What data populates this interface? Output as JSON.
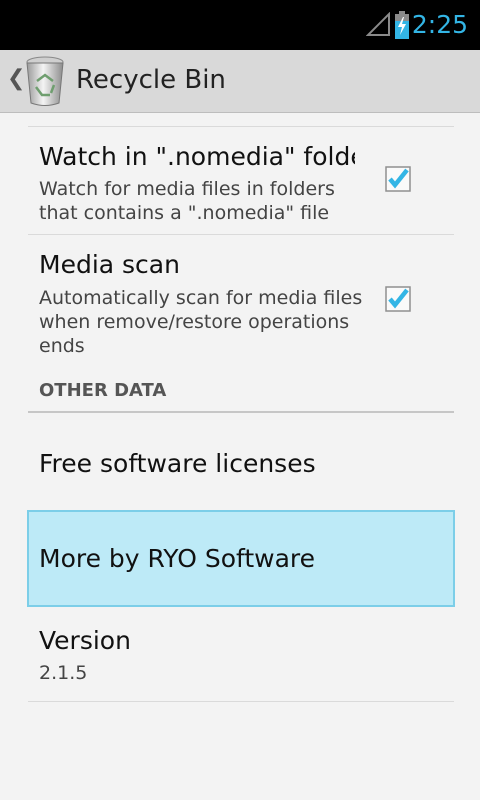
{
  "status_bar": {
    "time": "2:25",
    "icons": [
      "signal-icon",
      "battery-charging-icon"
    ],
    "time_color": "#33b5e5"
  },
  "action_bar": {
    "title": "Recycle Bin",
    "up_icon": "chevron-left-icon",
    "app_icon": "recycle-bin-icon"
  },
  "preferences": [
    {
      "title": "Watch in \".nomedia\" folder",
      "summary": "Watch for media files in folders that contains a \".nomedia\" file",
      "checked": true
    },
    {
      "title": "Media scan",
      "summary": "Automatically scan for media files when remove/restore operations ends",
      "checked": true
    }
  ],
  "section": {
    "label": "OTHER DATA"
  },
  "items": [
    {
      "title": "Free software licenses"
    },
    {
      "title": "More by RYO Software",
      "highlighted": true
    },
    {
      "title": "Version",
      "summary": "2.1.5"
    }
  ],
  "colors": {
    "accent": "#33b5e5",
    "highlight": "#bdeaf7",
    "check": "#33b5e5"
  }
}
